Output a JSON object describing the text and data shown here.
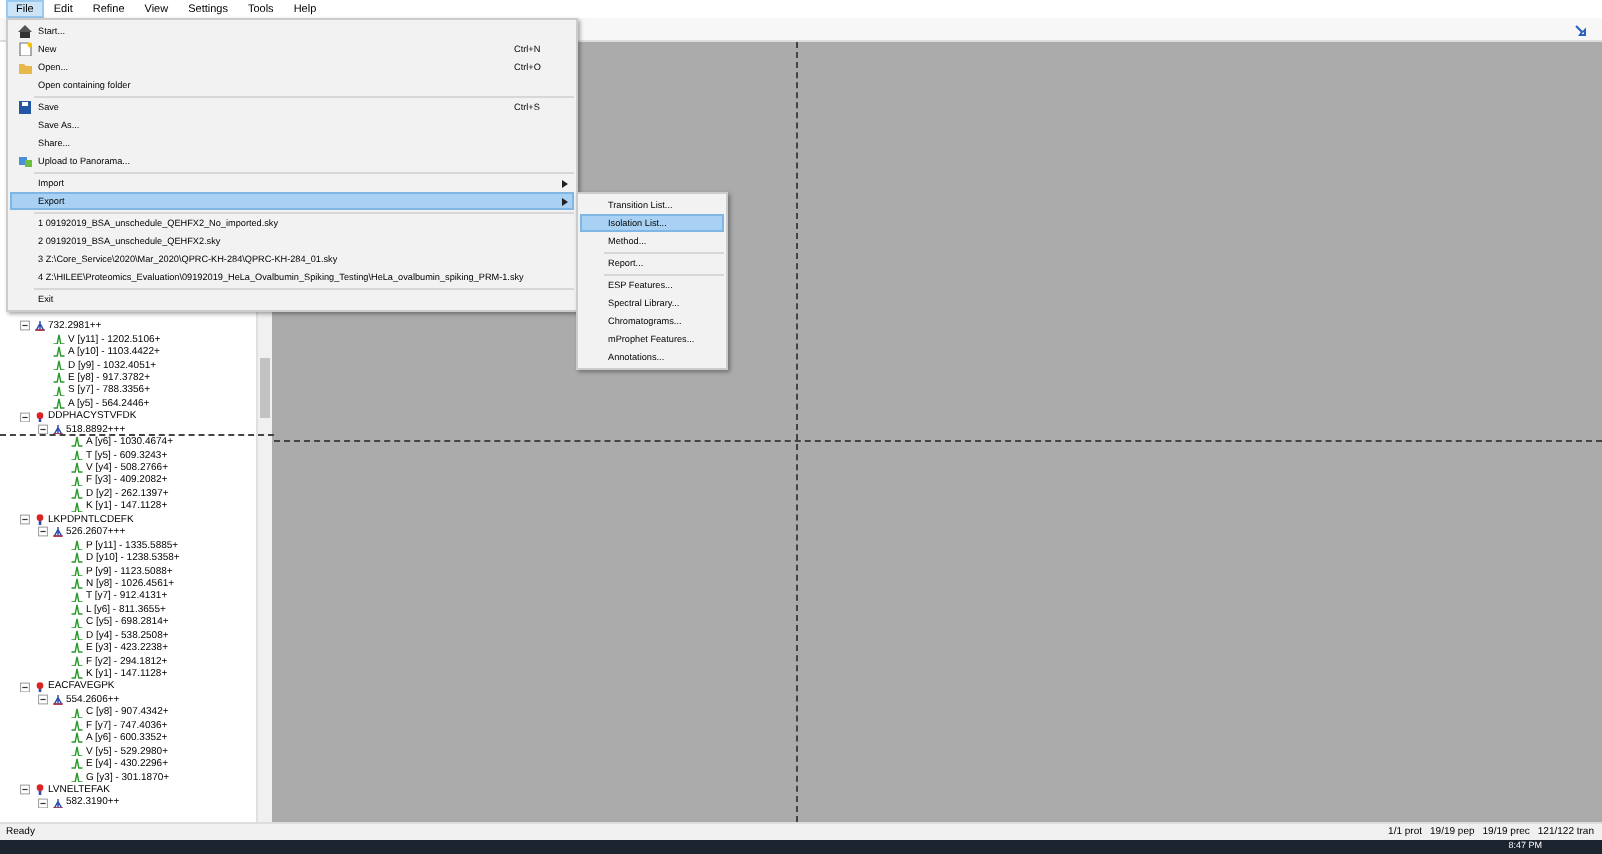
{
  "menu_bar": [
    {
      "label": "File",
      "selected": true
    },
    {
      "label": "Edit",
      "selected": false
    },
    {
      "label": "Refine",
      "selected": false
    },
    {
      "label": "View",
      "selected": false
    },
    {
      "label": "Settings",
      "selected": false
    },
    {
      "label": "Tools",
      "selected": false
    },
    {
      "label": "Help",
      "selected": false
    }
  ],
  "file_menu": {
    "groups": [
      [
        {
          "label": "Start...",
          "selected": false,
          "submenu": false
        },
        {
          "label": "New",
          "shortcut": "Ctrl+N",
          "selected": false,
          "submenu": false
        },
        {
          "label": "Open...",
          "shortcut": "Ctrl+O",
          "selected": false,
          "submenu": false
        },
        {
          "label": "Open containing folder",
          "selected": false,
          "submenu": false
        }
      ],
      [
        {
          "label": "Save",
          "shortcut": "Ctrl+S",
          "selected": false,
          "submenu": false
        },
        {
          "label": "Save As...",
          "selected": false,
          "submenu": false
        },
        {
          "label": "Share...",
          "selected": false,
          "submenu": false
        },
        {
          "label": "Upload to Panorama...",
          "selected": false,
          "submenu": false
        }
      ],
      [
        {
          "label": "Import",
          "selected": false,
          "submenu": true
        },
        {
          "label": "Export",
          "selected": true,
          "submenu": true
        }
      ],
      [
        {
          "label": "1 09192019_BSA_unschedule_QEHFX2_No_imported.sky",
          "selected": false,
          "submenu": false
        },
        {
          "label": "2 09192019_BSA_unschedule_QEHFX2.sky",
          "selected": false,
          "submenu": false
        },
        {
          "label": "3 Z:\\Core_Service\\2020\\Mar_2020\\QPRC-KH-284\\QPRC-KH-284_01.sky",
          "selected": false,
          "submenu": false
        },
        {
          "label": "4 Z:\\HILEE\\Proteomics_Evaluation\\09192019_HeLa_Ovalbumin_Spiking_Testing\\HeLa_ovalbumin_spiking_PRM-1.sky",
          "selected": false,
          "submenu": false
        }
      ],
      [
        {
          "label": "Exit",
          "selected": false,
          "submenu": false
        }
      ]
    ]
  },
  "export_menu": {
    "groups": [
      [
        {
          "label": "Transition List...",
          "selected": false
        },
        {
          "label": "Isolation List...",
          "selected": true
        },
        {
          "label": "Method...",
          "selected": false
        }
      ],
      [
        {
          "label": "Report...",
          "selected": false
        }
      ],
      [
        {
          "label": "ESP Features...",
          "selected": false
        },
        {
          "label": "Spectral Library...",
          "selected": false
        },
        {
          "label": "Chromatograms...",
          "selected": false
        },
        {
          "label": "mProphet Features...",
          "selected": false
        },
        {
          "label": "Annotations...",
          "selected": false
        }
      ]
    ]
  },
  "tree": [
    {
      "kind": "precursor",
      "label": "732.2981++",
      "expanded": true,
      "children": [
        {
          "kind": "transition",
          "label": "V [y11] - 1202.5106+"
        },
        {
          "kind": "transition",
          "label": "A [y10] - 1103.4422+"
        },
        {
          "kind": "transition",
          "label": "D [y9] - 1032.4051+"
        },
        {
          "kind": "transition",
          "label": "E [y8] - 917.3782+"
        },
        {
          "kind": "transition",
          "label": "S [y7] - 788.3356+"
        },
        {
          "kind": "transition",
          "label": "A [y5] - 564.2446+"
        }
      ]
    },
    {
      "kind": "peptide",
      "label": "DDPHACYSTVFDK",
      "expanded": true,
      "children": [
        {
          "kind": "precursor",
          "label": "518.8892+++",
          "expanded": true,
          "children": [
            {
              "kind": "transition",
              "label": "A [y6] - 1030.4674+"
            },
            {
              "kind": "transition",
              "label": "T [y5] - 609.3243+"
            },
            {
              "kind": "transition",
              "label": "V [y4] - 508.2766+"
            },
            {
              "kind": "transition",
              "label": "F [y3] - 409.2082+"
            },
            {
              "kind": "transition",
              "label": "D [y2] - 262.1397+"
            },
            {
              "kind": "transition",
              "label": "K [y1] - 147.1128+"
            }
          ]
        }
      ]
    },
    {
      "kind": "peptide",
      "label": "LKPDPNTLCDEFK",
      "expanded": true,
      "children": [
        {
          "kind": "precursor",
          "label": "526.2607+++",
          "expanded": true,
          "children": [
            {
              "kind": "transition",
              "label": "P [y11] - 1335.5885+"
            },
            {
              "kind": "transition",
              "label": "D [y10] - 1238.5358+"
            },
            {
              "kind": "transition",
              "label": "P [y9] - 1123.5088+"
            },
            {
              "kind": "transition",
              "label": "N [y8] - 1026.4561+"
            },
            {
              "kind": "transition",
              "label": "T [y7] - 912.4131+"
            },
            {
              "kind": "transition",
              "label": "L [y6] - 811.3655+"
            },
            {
              "kind": "transition",
              "label": "C [y5] - 698.2814+"
            },
            {
              "kind": "transition",
              "label": "D [y4] - 538.2508+"
            },
            {
              "kind": "transition",
              "label": "E [y3] - 423.2238+"
            },
            {
              "kind": "transition",
              "label": "F [y2] - 294.1812+"
            },
            {
              "kind": "transition",
              "label": "K [y1] - 147.1128+"
            }
          ]
        }
      ]
    },
    {
      "kind": "peptide",
      "label": "EACFAVEGPK",
      "expanded": true,
      "children": [
        {
          "kind": "precursor",
          "label": "554.2606++",
          "expanded": true,
          "children": [
            {
              "kind": "transition",
              "label": "C [y8] - 907.4342+"
            },
            {
              "kind": "transition",
              "label": "F [y7] - 747.4036+"
            },
            {
              "kind": "transition",
              "label": "A [y6] - 600.3352+"
            },
            {
              "kind": "transition",
              "label": "V [y5] - 529.2980+"
            },
            {
              "kind": "transition",
              "label": "E [y4] - 430.2296+"
            },
            {
              "kind": "transition",
              "label": "G [y3] - 301.1870+"
            }
          ]
        }
      ]
    },
    {
      "kind": "peptide",
      "label": "LVNELTEFAK",
      "expanded": true,
      "children": [
        {
          "kind": "precursor",
          "label": "582.3190++",
          "expanded": true
        }
      ]
    }
  ],
  "status_bar": {
    "message": "Ready",
    "counts": [
      "1/1 prot",
      "19/19 pep",
      "19/19 prec",
      "121/122 tran"
    ]
  },
  "taskbar": {
    "clock": "8:47 PM"
  }
}
